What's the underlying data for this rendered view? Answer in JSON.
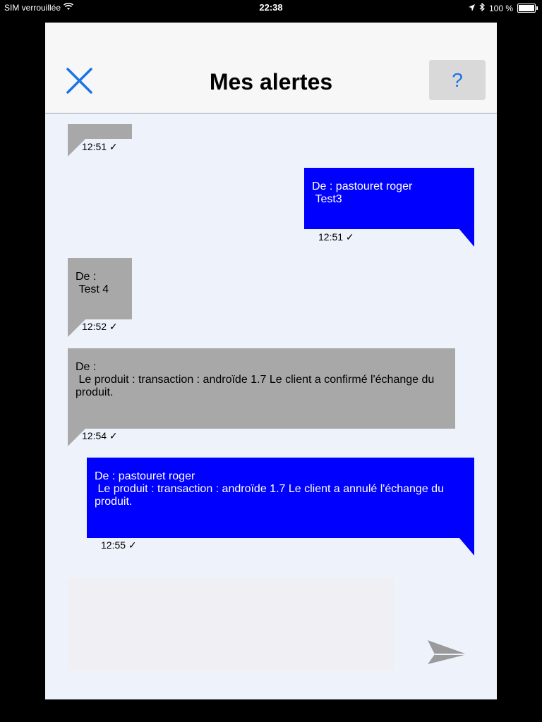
{
  "status_bar": {
    "carrier": "SIM verrouillée",
    "time": "22:38",
    "battery": "100 %"
  },
  "header": {
    "title": "Mes alertes",
    "help_label": "?"
  },
  "messages": [
    {
      "side": "received",
      "text": "",
      "time": "12:51 ✓"
    },
    {
      "side": "sent",
      "text": "De : pastouret roger\n Test3",
      "time": "12:51 ✓"
    },
    {
      "side": "received",
      "text": "De :\n Test 4",
      "time": "12:52 ✓"
    },
    {
      "side": "received",
      "text": "De :\n Le produit : transaction : androïde 1.7 Le client a confirmé l'échange du produit.",
      "time": "12:54 ✓"
    },
    {
      "side": "sent",
      "text": "De : pastouret roger\n Le produit : transaction : androïde 1.7 Le client a annulé l'échange du produit.",
      "time": "12:55 ✓"
    }
  ],
  "colors": {
    "sent_bubble": "#0000ff",
    "received_bubble": "#a8a8a8",
    "accent": "#1a73e8"
  }
}
